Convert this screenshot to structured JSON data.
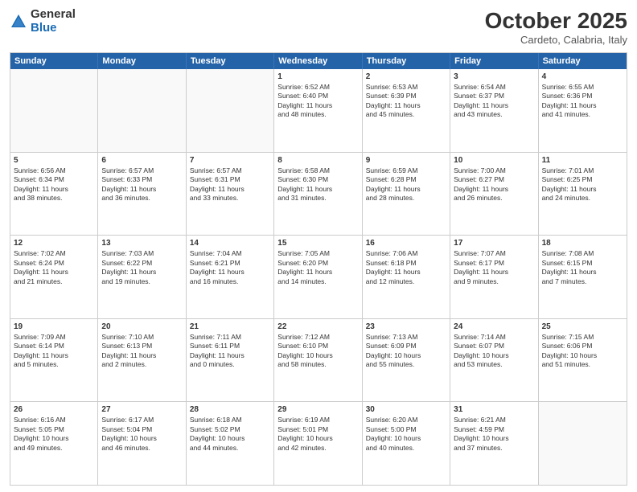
{
  "header": {
    "logo": {
      "general": "General",
      "blue": "Blue"
    },
    "title": "October 2025",
    "subtitle": "Cardeto, Calabria, Italy"
  },
  "dayHeaders": [
    "Sunday",
    "Monday",
    "Tuesday",
    "Wednesday",
    "Thursday",
    "Friday",
    "Saturday"
  ],
  "weeks": [
    [
      {
        "day": "",
        "info": "",
        "empty": true
      },
      {
        "day": "",
        "info": "",
        "empty": true
      },
      {
        "day": "",
        "info": "",
        "empty": true
      },
      {
        "day": "1",
        "info": "Sunrise: 6:52 AM\nSunset: 6:40 PM\nDaylight: 11 hours\nand 48 minutes."
      },
      {
        "day": "2",
        "info": "Sunrise: 6:53 AM\nSunset: 6:39 PM\nDaylight: 11 hours\nand 45 minutes."
      },
      {
        "day": "3",
        "info": "Sunrise: 6:54 AM\nSunset: 6:37 PM\nDaylight: 11 hours\nand 43 minutes."
      },
      {
        "day": "4",
        "info": "Sunrise: 6:55 AM\nSunset: 6:36 PM\nDaylight: 11 hours\nand 41 minutes."
      }
    ],
    [
      {
        "day": "5",
        "info": "Sunrise: 6:56 AM\nSunset: 6:34 PM\nDaylight: 11 hours\nand 38 minutes."
      },
      {
        "day": "6",
        "info": "Sunrise: 6:57 AM\nSunset: 6:33 PM\nDaylight: 11 hours\nand 36 minutes."
      },
      {
        "day": "7",
        "info": "Sunrise: 6:57 AM\nSunset: 6:31 PM\nDaylight: 11 hours\nand 33 minutes."
      },
      {
        "day": "8",
        "info": "Sunrise: 6:58 AM\nSunset: 6:30 PM\nDaylight: 11 hours\nand 31 minutes."
      },
      {
        "day": "9",
        "info": "Sunrise: 6:59 AM\nSunset: 6:28 PM\nDaylight: 11 hours\nand 28 minutes."
      },
      {
        "day": "10",
        "info": "Sunrise: 7:00 AM\nSunset: 6:27 PM\nDaylight: 11 hours\nand 26 minutes."
      },
      {
        "day": "11",
        "info": "Sunrise: 7:01 AM\nSunset: 6:25 PM\nDaylight: 11 hours\nand 24 minutes."
      }
    ],
    [
      {
        "day": "12",
        "info": "Sunrise: 7:02 AM\nSunset: 6:24 PM\nDaylight: 11 hours\nand 21 minutes."
      },
      {
        "day": "13",
        "info": "Sunrise: 7:03 AM\nSunset: 6:22 PM\nDaylight: 11 hours\nand 19 minutes."
      },
      {
        "day": "14",
        "info": "Sunrise: 7:04 AM\nSunset: 6:21 PM\nDaylight: 11 hours\nand 16 minutes."
      },
      {
        "day": "15",
        "info": "Sunrise: 7:05 AM\nSunset: 6:20 PM\nDaylight: 11 hours\nand 14 minutes."
      },
      {
        "day": "16",
        "info": "Sunrise: 7:06 AM\nSunset: 6:18 PM\nDaylight: 11 hours\nand 12 minutes."
      },
      {
        "day": "17",
        "info": "Sunrise: 7:07 AM\nSunset: 6:17 PM\nDaylight: 11 hours\nand 9 minutes."
      },
      {
        "day": "18",
        "info": "Sunrise: 7:08 AM\nSunset: 6:15 PM\nDaylight: 11 hours\nand 7 minutes."
      }
    ],
    [
      {
        "day": "19",
        "info": "Sunrise: 7:09 AM\nSunset: 6:14 PM\nDaylight: 11 hours\nand 5 minutes."
      },
      {
        "day": "20",
        "info": "Sunrise: 7:10 AM\nSunset: 6:13 PM\nDaylight: 11 hours\nand 2 minutes."
      },
      {
        "day": "21",
        "info": "Sunrise: 7:11 AM\nSunset: 6:11 PM\nDaylight: 11 hours\nand 0 minutes."
      },
      {
        "day": "22",
        "info": "Sunrise: 7:12 AM\nSunset: 6:10 PM\nDaylight: 10 hours\nand 58 minutes."
      },
      {
        "day": "23",
        "info": "Sunrise: 7:13 AM\nSunset: 6:09 PM\nDaylight: 10 hours\nand 55 minutes."
      },
      {
        "day": "24",
        "info": "Sunrise: 7:14 AM\nSunset: 6:07 PM\nDaylight: 10 hours\nand 53 minutes."
      },
      {
        "day": "25",
        "info": "Sunrise: 7:15 AM\nSunset: 6:06 PM\nDaylight: 10 hours\nand 51 minutes."
      }
    ],
    [
      {
        "day": "26",
        "info": "Sunrise: 6:16 AM\nSunset: 5:05 PM\nDaylight: 10 hours\nand 49 minutes."
      },
      {
        "day": "27",
        "info": "Sunrise: 6:17 AM\nSunset: 5:04 PM\nDaylight: 10 hours\nand 46 minutes."
      },
      {
        "day": "28",
        "info": "Sunrise: 6:18 AM\nSunset: 5:02 PM\nDaylight: 10 hours\nand 44 minutes."
      },
      {
        "day": "29",
        "info": "Sunrise: 6:19 AM\nSunset: 5:01 PM\nDaylight: 10 hours\nand 42 minutes."
      },
      {
        "day": "30",
        "info": "Sunrise: 6:20 AM\nSunset: 5:00 PM\nDaylight: 10 hours\nand 40 minutes."
      },
      {
        "day": "31",
        "info": "Sunrise: 6:21 AM\nSunset: 4:59 PM\nDaylight: 10 hours\nand 37 minutes."
      },
      {
        "day": "",
        "info": "",
        "empty": true
      }
    ]
  ]
}
